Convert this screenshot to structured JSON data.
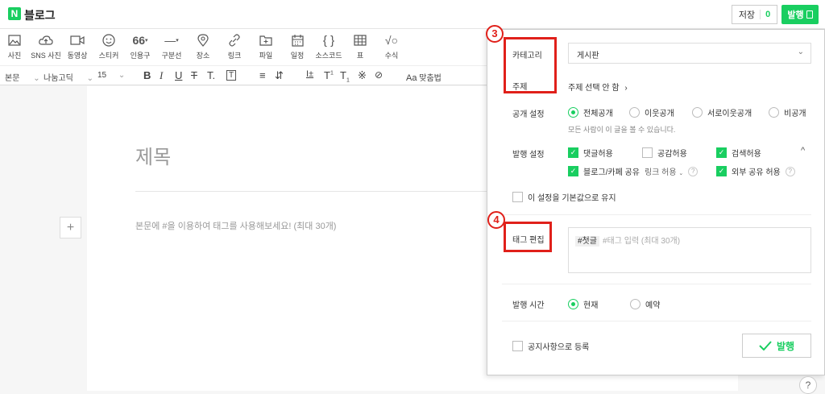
{
  "header": {
    "logo": "N",
    "title": "블로그",
    "save_label": "저장",
    "save_count": "0",
    "publish_label": "발행"
  },
  "toolbar": {
    "tools": [
      {
        "label": "사진",
        "icon": "photo-icon"
      },
      {
        "label": "SNS 사진",
        "icon": "cloud-upload-icon"
      },
      {
        "label": "동영상",
        "icon": "video-icon"
      },
      {
        "label": "스티커",
        "icon": "sticker-icon"
      },
      {
        "label": "인용구",
        "icon": "quote-icon"
      },
      {
        "label": "구분선",
        "icon": "divider-line-icon"
      },
      {
        "label": "장소",
        "icon": "location-icon"
      },
      {
        "label": "링크",
        "icon": "link-icon"
      },
      {
        "label": "파일",
        "icon": "file-icon"
      },
      {
        "label": "일정",
        "icon": "calendar-icon"
      },
      {
        "label": "소스코드",
        "icon": "code-braces-icon"
      },
      {
        "label": "표",
        "icon": "table-icon"
      },
      {
        "label": "수식",
        "icon": "formula-icon"
      }
    ],
    "format": {
      "style": "본문",
      "font": "나눔고딕",
      "size": "15",
      "spellcheck": "맞춤법"
    }
  },
  "editor": {
    "title_placeholder": "제목",
    "body_placeholder": "본문에 #을 이용하여 태그를 사용해보세요! (최대 30개)"
  },
  "panel": {
    "category_label": "카테고리",
    "category_value": "게시판",
    "topic_label": "주제",
    "topic_value": "주제 선택 안 함",
    "visibility_label": "공개 설정",
    "visibility_options": [
      "전체공개",
      "이웃공개",
      "서로이웃공개",
      "비공개"
    ],
    "visibility_note": "모든 사람이 이 글을 볼 수 있습니다.",
    "publish_settings_label": "발행 설정",
    "opt_comment": "댓글허용",
    "opt_empathy": "공감허용",
    "opt_search": "검색허용",
    "opt_share": "블로그/카페 공유",
    "opt_share_link": "링크 허용",
    "opt_external": "외부 공유 허용",
    "default_label": "이 설정을 기본값으로 유지",
    "tag_label": "태그 편집",
    "tag_chip": "#첫글",
    "tag_placeholder": "#태그 입력 (최대 30개)",
    "time_label": "발행 시간",
    "time_now": "현재",
    "time_reserve": "예약",
    "notice_label": "공지사항으로 등록",
    "publish_button": "발행",
    "badge3": "3",
    "badge4": "4"
  },
  "colors": {
    "accent": "#19ce60",
    "annotation_red": "#e0201a"
  }
}
